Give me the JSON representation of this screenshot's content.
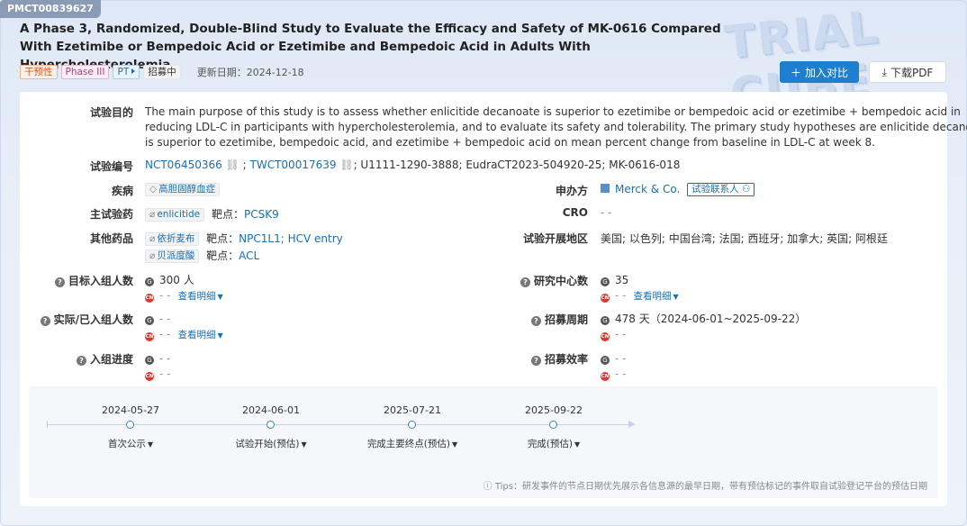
{
  "id_badge": "PMCT00839627",
  "title": "A Phase 3, Randomized, Double-Blind Study to Evaluate the Efficacy and Safety of MK-0616 Compared With Ezetimibe or Bempedoic Acid or Ezetimibe and Bempedoic Acid in Adults With Hypercholesterolemia",
  "tags": {
    "intervention": "干预性",
    "phase": "Phase III",
    "pt": "PT",
    "status": "招募中"
  },
  "update_label": "更新日期：",
  "update_date": "2024-12-18",
  "buttons": {
    "add_compare": "加入对比",
    "download_pdf": "下载PDF"
  },
  "purpose": {
    "label": "试验目的",
    "line1": "The main purpose of this study is to assess whether enlicitide decanoate is superior to ezetimibe or bempedoic acid or ezetimibe + bempedoic acid in",
    "line2": "reducing LDL-C in participants with hypercholesterolemia, and to evaluate its safety and tolerability. The primary study hypotheses are enlicitide decanoate",
    "line3": "is superior to ezetimibe, bempedoic acid, and ezetimibe + bempedoic acid on mean percent change from baseline in LDL-C at week 8."
  },
  "trial_ids": {
    "label": "试验编号",
    "nct": "NCT06450366",
    "twct": "TWCT00017639",
    "rest": "; U1111-1290-3888; EudraCT2023-504920-25; MK-0616-018"
  },
  "disease": {
    "label": "疾病",
    "value": "高胆固醇血症"
  },
  "sponsor": {
    "label": "申办方",
    "value": "Merck & Co.",
    "contact": "试验联系人"
  },
  "main_drug": {
    "label": "主试验药",
    "drug": "enlicitide",
    "target_label": "靶点：",
    "target": "PCSK9"
  },
  "cro": {
    "label": "CRO",
    "value": "- -"
  },
  "other_drugs": {
    "label": "其他药品",
    "drug1": "依折麦布",
    "target_label": "靶点：",
    "target1": "NPC1L1; HCV entry",
    "drug2": "贝派度酸",
    "target2": "ACL"
  },
  "regions": {
    "label": "试验开展地区",
    "value": "美国; 以色列; 中国台湾; 法国; 西班牙; 加拿大; 英国; 阿根廷"
  },
  "target_enroll": {
    "label": "目标入组人数",
    "global": "300 人",
    "cn": "- -",
    "more": "查看明细"
  },
  "centers": {
    "label": "研究中心数",
    "global": "35",
    "cn": "- -",
    "more": "查看明细"
  },
  "actual_enroll": {
    "label": "实际/已入组人数",
    "global": "- -",
    "cn": "- -",
    "more": "查看明细"
  },
  "recruit_period": {
    "label": "招募周期",
    "global": "478 天（2024-06-01~2025-09-22）",
    "cn": "- -"
  },
  "enroll_progress": {
    "label": "入组进度",
    "global": "- -",
    "cn": "- -"
  },
  "recruit_efficiency": {
    "label": "招募效率",
    "global": "- -",
    "cn": "- -"
  },
  "source_marks": {
    "global": "G",
    "cn": "CN"
  },
  "timeline": [
    {
      "date": "2024-05-27",
      "event": "首次公示"
    },
    {
      "date": "2024-06-01",
      "event": "试验开始(预估)"
    },
    {
      "date": "2025-07-21",
      "event": "完成主要终点(预估)"
    },
    {
      "date": "2025-09-22",
      "event": "完成(预估)"
    }
  ],
  "tips": "ⓘ Tips：研发事件的节点日期优先展示各信息源的最早日期，带有预估标记的事件取自试验登记平台的预估日期",
  "watermark": "TRIAL CUBE"
}
